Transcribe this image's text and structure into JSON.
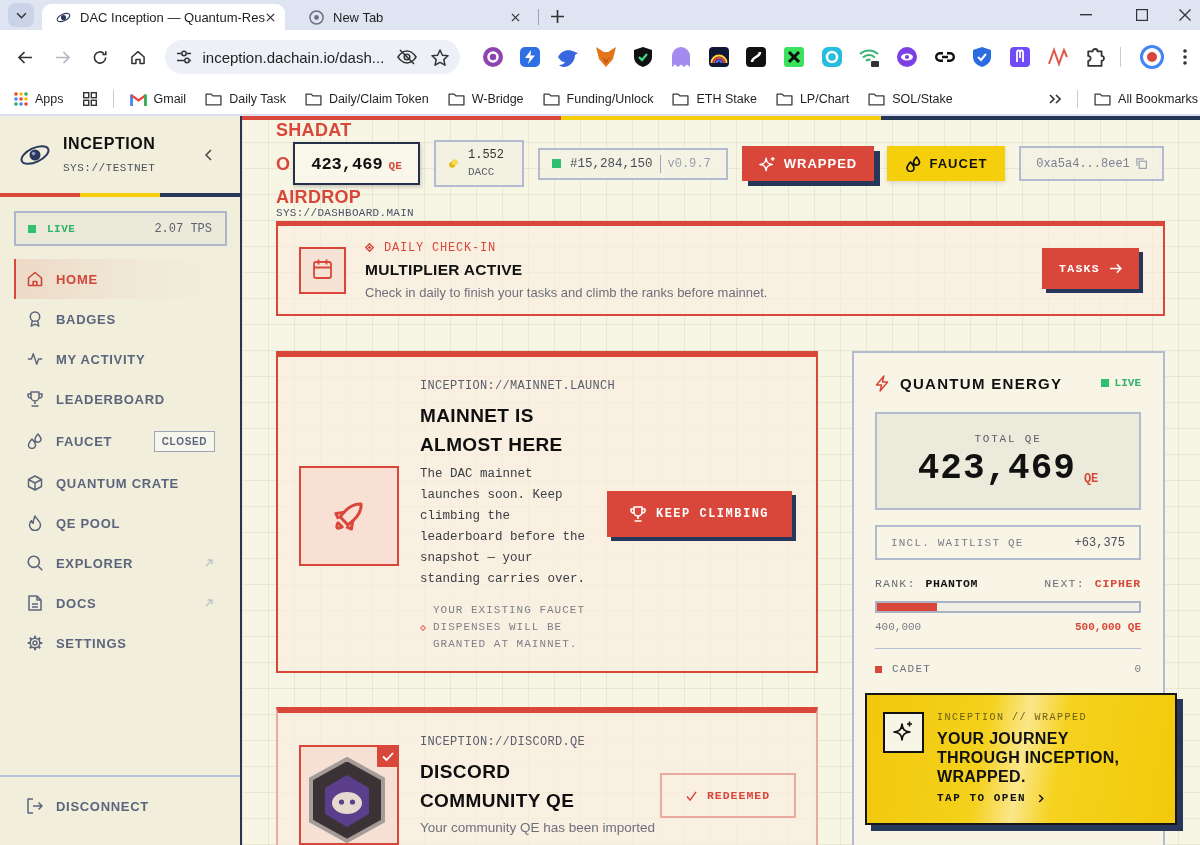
{
  "browser": {
    "tabs": [
      {
        "title": "DAC Inception — Quantum-Res",
        "selected": true
      },
      {
        "title": "New Tab",
        "selected": false
      }
    ],
    "forward_enabled": false,
    "address": "inception.dachain.io/dash...",
    "bookmarks": [
      {
        "kind": "apps",
        "label": "Apps"
      },
      {
        "kind": "grid"
      },
      {
        "kind": "mail",
        "label": "Gmail"
      },
      {
        "kind": "folder",
        "label": "Daily Task"
      },
      {
        "kind": "folder",
        "label": "Daily/Claim Token"
      },
      {
        "kind": "folder",
        "label": "W-Bridge"
      },
      {
        "kind": "folder",
        "label": "Funding/Unlock"
      },
      {
        "kind": "folder",
        "label": "ETH Stake"
      },
      {
        "kind": "folder",
        "label": "LP/Chart"
      },
      {
        "kind": "folder",
        "label": "SOL/Stake"
      }
    ],
    "all_bookmarks": "All Bookmarks"
  },
  "sidebar": {
    "brand": "INCEPTION",
    "network": "SYS://TESTNET",
    "status": {
      "label": "LIVE",
      "reading": "2.07 TPS"
    },
    "items": [
      {
        "label": "HOME",
        "selected": true,
        "external": false
      },
      {
        "label": "BADGES",
        "selected": false,
        "external": false
      },
      {
        "label": "MY ACTIVITY",
        "selected": false,
        "external": false
      },
      {
        "label": "LEADERBOARD",
        "selected": false,
        "external": false
      },
      {
        "label": "FAUCET",
        "selected": false,
        "external": false,
        "badge": "CLOSED"
      },
      {
        "label": "QUANTUM CRATE",
        "selected": false,
        "external": false
      },
      {
        "label": "QE POOL",
        "selected": false,
        "external": false
      },
      {
        "label": "EXPLORER",
        "selected": false,
        "external": true
      },
      {
        "label": "DOCS",
        "selected": false,
        "external": true
      },
      {
        "label": "SETTINGS",
        "selected": false,
        "external": false
      }
    ],
    "disconnect": "DISCONNECT"
  },
  "header": {
    "title_lines": [
      "SHADAT",
      "O",
      "AIRDROP"
    ],
    "balance": {
      "value": "423,469",
      "unit": "QE"
    },
    "token": {
      "value": "1.552",
      "unit": "DACC"
    },
    "block": {
      "number": "#15,284,150",
      "version": "v0.9.7"
    },
    "actions": [
      {
        "kind": "wrapped",
        "label": "WRAPPED"
      },
      {
        "kind": "faucet",
        "label": "FAUCET"
      }
    ],
    "address": "0xa5a4...8ee1"
  },
  "breadcrumb": "SYS://DASHBOARD.MAIN",
  "checkin": {
    "eyebrow": "DAILY CHECK-IN",
    "title": "MULTIPLIER ACTIVE",
    "text": "Check in daily to finish your tasks and climb the ranks before mainnet.",
    "button": "TASKS"
  },
  "cards": [
    {
      "kind": "launch",
      "path": "INCEPTION://MAINNET.LAUNCH",
      "title": "MAINNET IS ALMOST HERE",
      "text": "The DAC mainnet launches soon. Keep climbing the leaderboard before the snapshot — your standing carries over.",
      "note": "YOUR EXISTING FAUCET DISPENSES WILL BE GRANTED AT MAINNET.",
      "button": "KEEP CLIMBING"
    },
    {
      "kind": "discord",
      "path": "INCEPTION://DISCORD.QE",
      "title": "DISCORD COMMUNITY QE",
      "text": "Your community QE has been imported",
      "status": "REDEEMED",
      "claimed": true
    }
  ],
  "energy": {
    "title": "QUANTUM ENERGY",
    "live": "LIVE",
    "total_label": "TOTAL QE",
    "total": "423,469",
    "unit": "QE",
    "waitlist_label": "INCL. WAITLIST QE",
    "waitlist": "+63,375",
    "rank_label": "RANK:",
    "rank": "PHANTOM",
    "next_label": "NEXT:",
    "next": "CIPHER",
    "level": 0.23,
    "min": "400,000",
    "max": "500,000 QE",
    "tiers": [
      {
        "name": "CADET",
        "value": "0",
        "color": "#d8473a"
      }
    ]
  },
  "wrapped_popup": {
    "eyebrow": "INCEPTION // WRAPPED",
    "title": "YOUR JOURNEY THROUGH INCEPTION, WRAPPED.",
    "action": "TAP TO OPEN"
  }
}
